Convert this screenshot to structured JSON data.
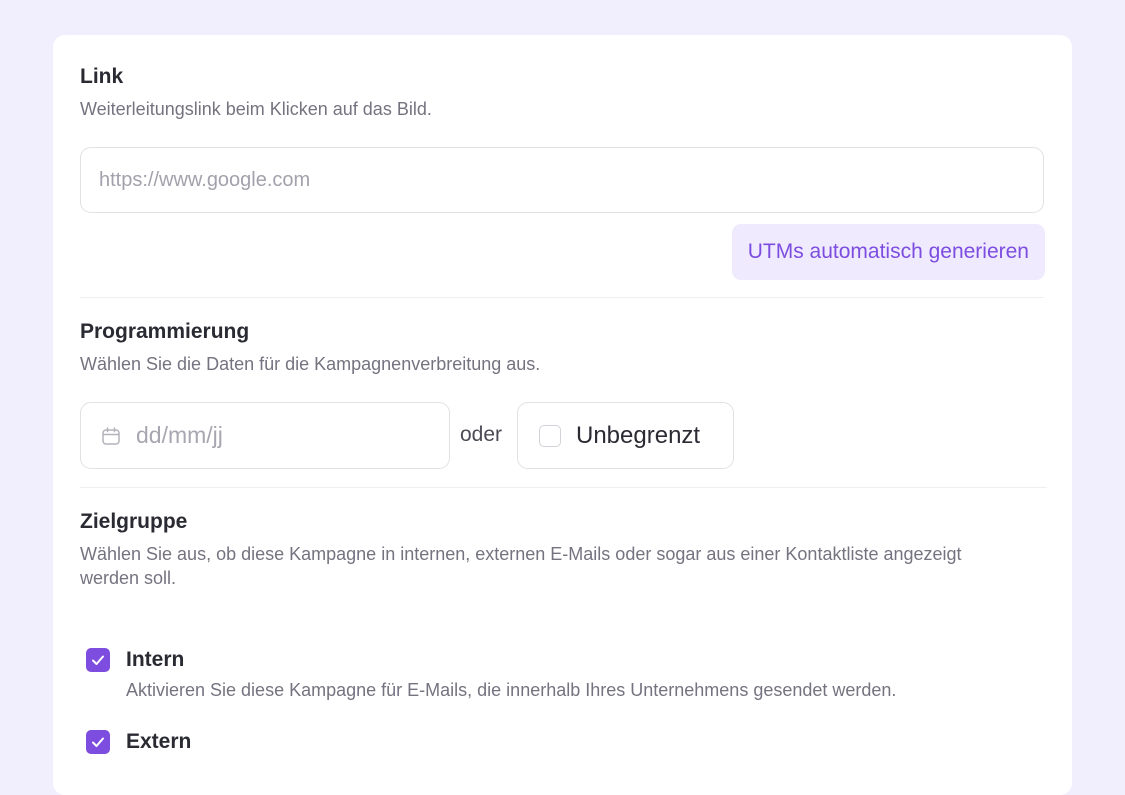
{
  "link": {
    "title": "Link",
    "description": "Weiterleitungslink beim Klicken auf das Bild.",
    "url_value": "",
    "url_placeholder": "https://www.google.com",
    "utm_button_label": "UTMs automatisch generieren"
  },
  "schedule": {
    "title": "Programmierung",
    "description": "Wählen Sie die Daten für die Kampagnenverbreitung aus.",
    "date_placeholder": "dd/mm/jj",
    "or_label": "oder",
    "unlimited_label": "Unbegrenzt",
    "unlimited_checked": false
  },
  "audience": {
    "title": "Zielgruppe",
    "description_line1": "Wählen Sie aus, ob diese Kampagne in internen, externen E-Mails oder sogar aus einer Kontaktliste angezeigt",
    "description_line2": "werden soll.",
    "options": [
      {
        "label": "Intern",
        "description": "Aktivieren Sie diese Kampagne für E-Mails, die innerhalb Ihres Unternehmens gesendet werden.",
        "checked": true
      },
      {
        "label": "Extern",
        "checked": true
      }
    ]
  },
  "icons": {
    "calendar": "calendar-icon",
    "check": "checkmark-icon"
  },
  "colors": {
    "accent": "#7c4ddf",
    "accent_soft": "#efeafe",
    "page_background": "#f1effd",
    "card_background": "#ffffff"
  }
}
